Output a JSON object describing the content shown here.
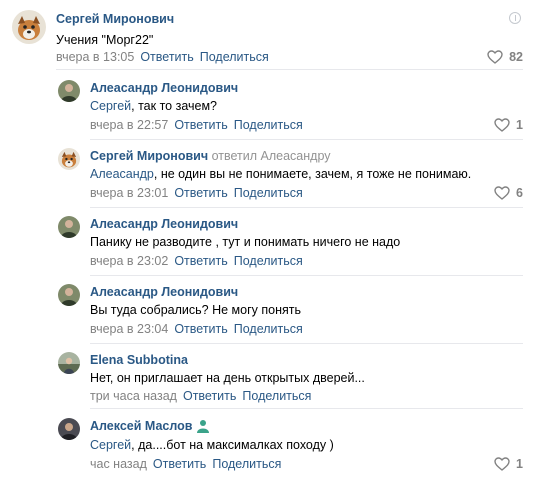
{
  "labels": {
    "reply": "Ответить",
    "share": "Поделиться"
  },
  "comments": [
    {
      "author": "Сергей Миронович",
      "replied_to": "",
      "mention": "",
      "text": "Учения \"Морг22\"",
      "time": "вчера в 13:05",
      "likes": "82",
      "avatar": "dog-avatar"
    },
    {
      "author": "Алеасандр Леонидович",
      "replied_to": "",
      "mention": "Сергей",
      "text": ", так то зачем?",
      "time": "вчера в 22:57",
      "likes": "1",
      "avatar": "man-avatar"
    },
    {
      "author": "Сергей Миронович",
      "replied_to": "ответил Алеасандру",
      "mention": "Алеасандр",
      "text": ", не один вы не понимаете, зачем, я тоже не понимаю.",
      "time": "вчера в 23:01",
      "likes": "6",
      "avatar": "dog-avatar"
    },
    {
      "author": "Алеасандр Леонидович",
      "replied_to": "",
      "mention": "",
      "text": "Панику не разводите , тут и понимать ничего не надо",
      "time": "вчера в 23:02",
      "likes": "",
      "avatar": "man-avatar"
    },
    {
      "author": "Алеасандр Леонидович",
      "replied_to": "",
      "mention": "",
      "text": "Вы туда собрались? Не могу понять",
      "time": "вчера в 23:04",
      "likes": "",
      "avatar": "man-avatar"
    },
    {
      "author": "Elena Subbotina",
      "replied_to": "",
      "mention": "",
      "text": "Нет, он приглашает на день открытых дверей...",
      "time": "три часа назад",
      "likes": "",
      "avatar": "outdoor-avatar"
    },
    {
      "author": "Алексей Маслов",
      "replied_to": "",
      "mention": "Сергей",
      "text": ", да....бот на максималках походу )",
      "time": "час назад",
      "likes": "1",
      "avatar": "person-avatar",
      "badge": "user-badge-icon"
    }
  ],
  "colors": {
    "link": "#2a5885",
    "muted": "#828282",
    "separator": "#e7e8ec"
  }
}
